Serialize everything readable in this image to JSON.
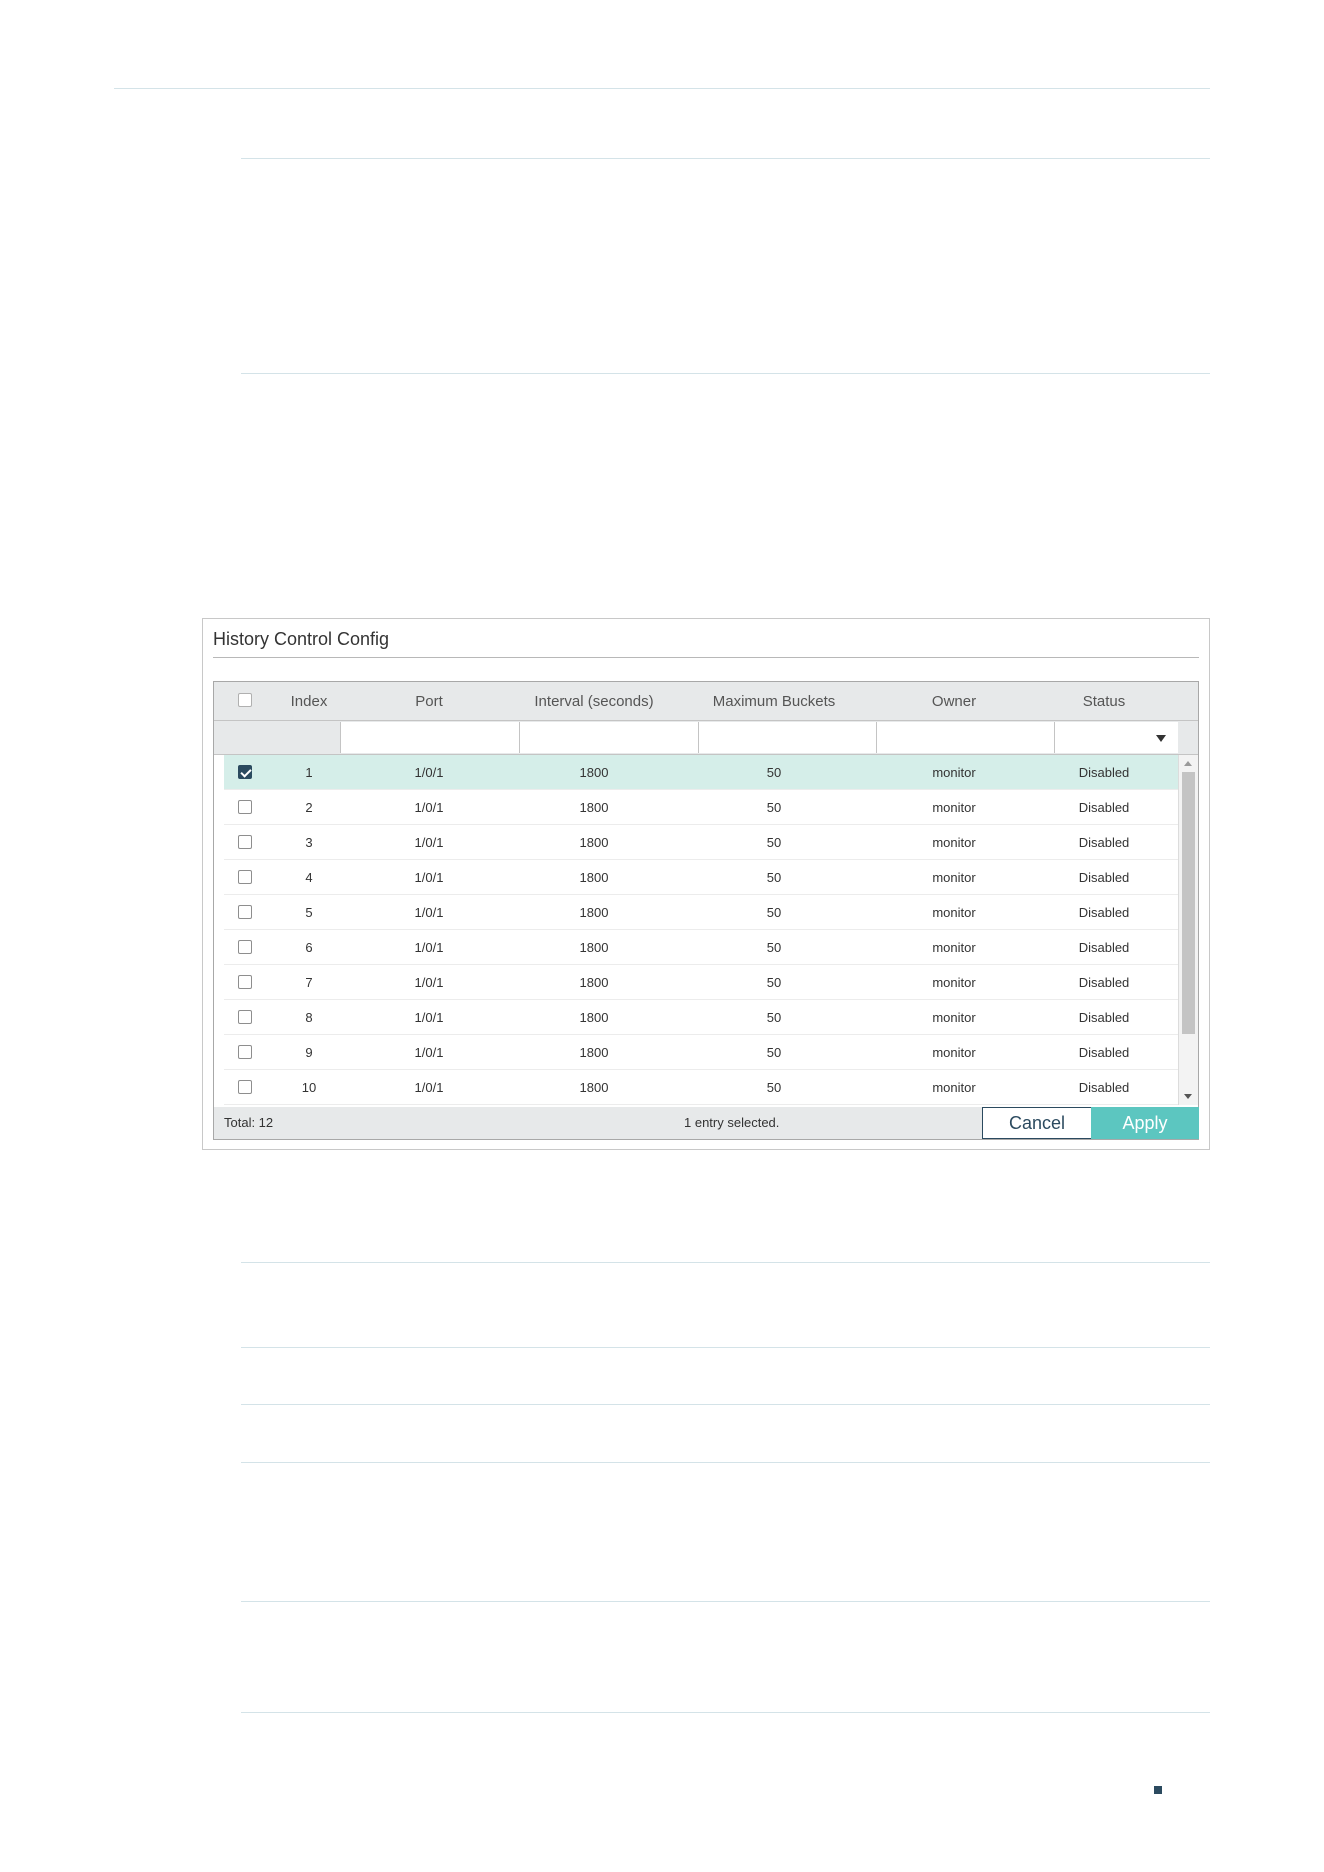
{
  "panel": {
    "title": "History Control Config",
    "columns": [
      "Index",
      "Port",
      "Interval (seconds)",
      "Maximum Buckets",
      "Owner",
      "Status"
    ],
    "rows": [
      {
        "checked": true,
        "index": "1",
        "port": "1/0/1",
        "interval": "1800",
        "buckets": "50",
        "owner": "monitor",
        "status": "Disabled"
      },
      {
        "checked": false,
        "index": "2",
        "port": "1/0/1",
        "interval": "1800",
        "buckets": "50",
        "owner": "monitor",
        "status": "Disabled"
      },
      {
        "checked": false,
        "index": "3",
        "port": "1/0/1",
        "interval": "1800",
        "buckets": "50",
        "owner": "monitor",
        "status": "Disabled"
      },
      {
        "checked": false,
        "index": "4",
        "port": "1/0/1",
        "interval": "1800",
        "buckets": "50",
        "owner": "monitor",
        "status": "Disabled"
      },
      {
        "checked": false,
        "index": "5",
        "port": "1/0/1",
        "interval": "1800",
        "buckets": "50",
        "owner": "monitor",
        "status": "Disabled"
      },
      {
        "checked": false,
        "index": "6",
        "port": "1/0/1",
        "interval": "1800",
        "buckets": "50",
        "owner": "monitor",
        "status": "Disabled"
      },
      {
        "checked": false,
        "index": "7",
        "port": "1/0/1",
        "interval": "1800",
        "buckets": "50",
        "owner": "monitor",
        "status": "Disabled"
      },
      {
        "checked": false,
        "index": "8",
        "port": "1/0/1",
        "interval": "1800",
        "buckets": "50",
        "owner": "monitor",
        "status": "Disabled"
      },
      {
        "checked": false,
        "index": "9",
        "port": "1/0/1",
        "interval": "1800",
        "buckets": "50",
        "owner": "monitor",
        "status": "Disabled"
      },
      {
        "checked": false,
        "index": "10",
        "port": "1/0/1",
        "interval": "1800",
        "buckets": "50",
        "owner": "monitor",
        "status": "Disabled"
      }
    ],
    "footer": {
      "total": "Total: 12",
      "selection": "1 entry selected.",
      "cancel_label": "Cancel",
      "apply_label": "Apply"
    }
  },
  "colors": {
    "accent": "#5cc6c0",
    "dark": "#2b4a5f",
    "selected_row": "#d5eee9"
  }
}
